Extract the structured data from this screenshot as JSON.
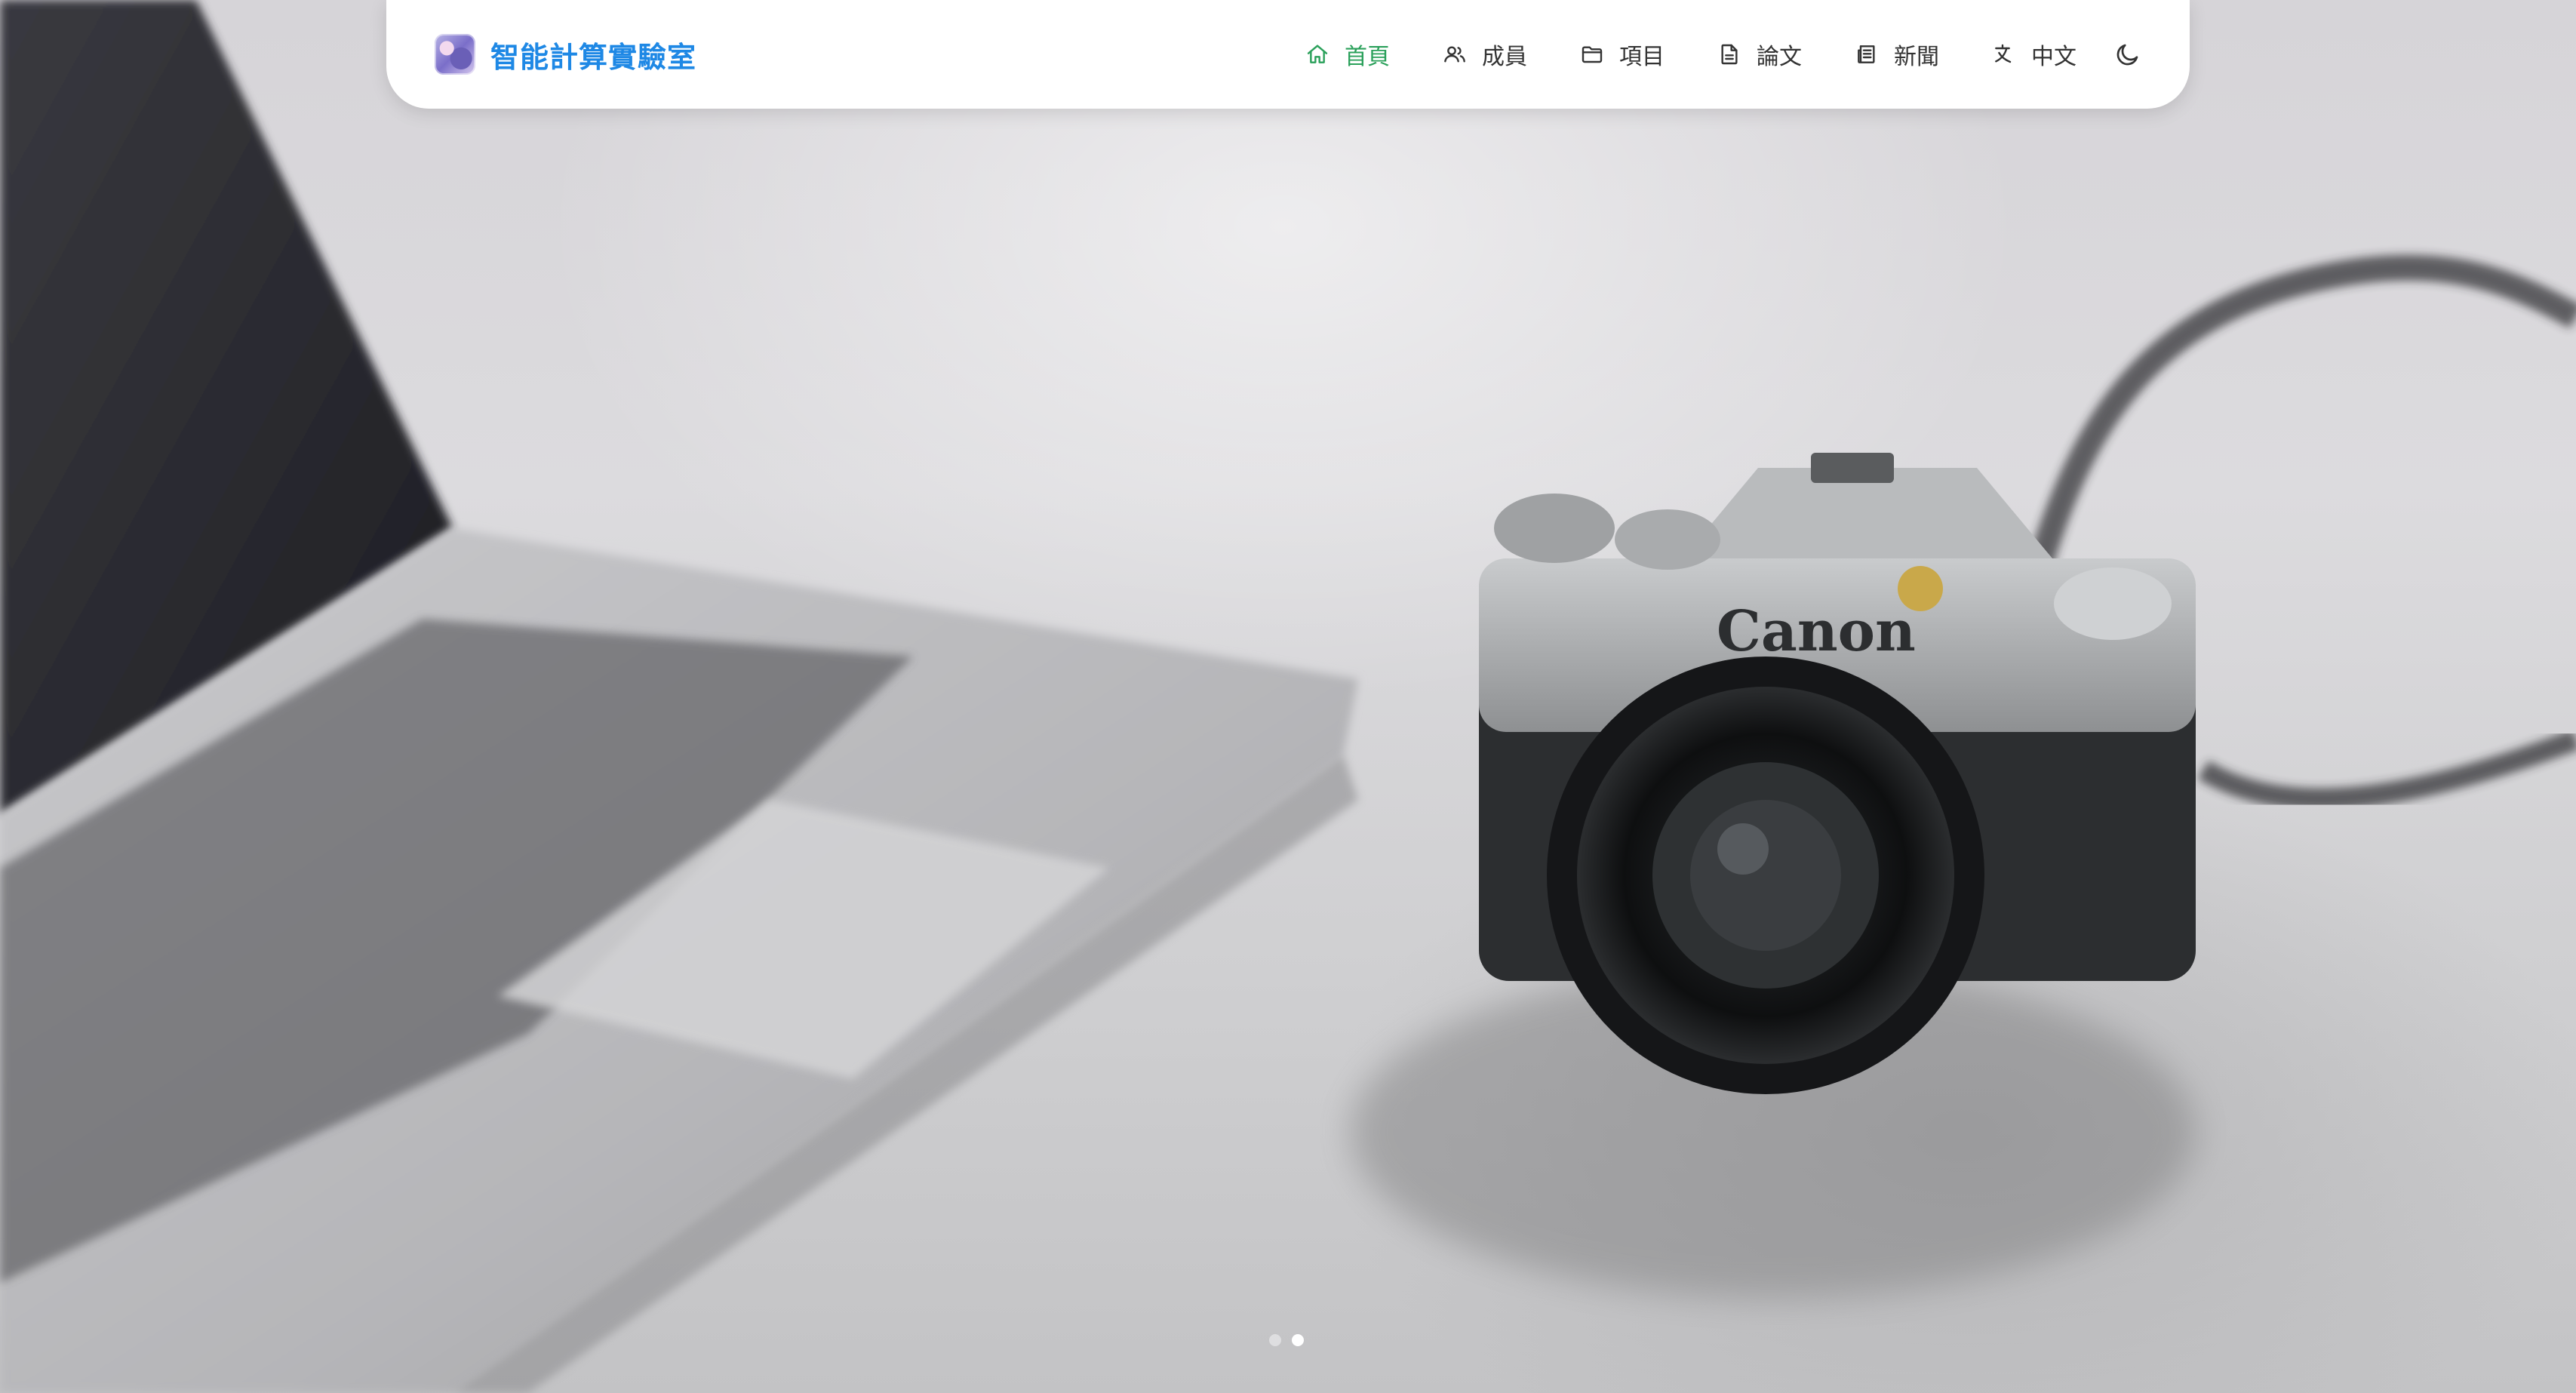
{
  "brand": {
    "title": "智能計算實驗室",
    "logo_icon": "lab-logo-icon"
  },
  "nav": {
    "items": [
      {
        "label": "首頁",
        "icon": "home-icon",
        "active": true
      },
      {
        "label": "成員",
        "icon": "users-icon",
        "active": false
      },
      {
        "label": "項目",
        "icon": "folder-icon",
        "active": false
      },
      {
        "label": "論文",
        "icon": "document-icon",
        "active": false
      },
      {
        "label": "新聞",
        "icon": "newspaper-icon",
        "active": false
      },
      {
        "label": "中文",
        "icon": "translate-icon",
        "active": false
      }
    ],
    "theme_toggle_icon": "moon-icon"
  },
  "carousel": {
    "slide_count": 2,
    "active_index": 1
  },
  "colors": {
    "brand_blue": "#1e88e5",
    "active_green": "#2aa05a",
    "nav_text": "#333333",
    "navbar_bg": "#ffffff"
  }
}
